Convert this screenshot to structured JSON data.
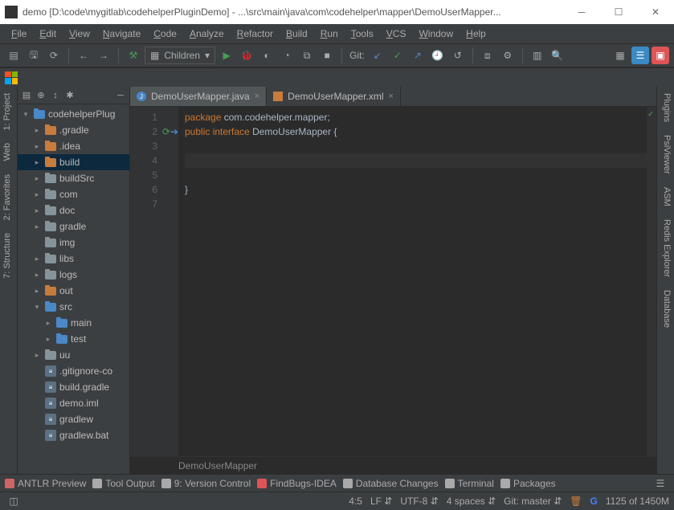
{
  "window": {
    "title": "demo [D:\\code\\mygitlab\\codehelperPluginDemo] - ...\\src\\main\\java\\com\\codehelper\\mapper\\DemoUserMapper..."
  },
  "menubar": [
    "File",
    "Edit",
    "View",
    "Navigate",
    "Code",
    "Analyze",
    "Refactor",
    "Build",
    "Run",
    "Tools",
    "VCS",
    "Window",
    "Help"
  ],
  "toolbar": {
    "config_label": "Children",
    "git_label": "Git:"
  },
  "left_tools": [
    "1: Project",
    "Web",
    "2: Favorites",
    "7: Structure"
  ],
  "right_tools": [
    "Plugins",
    "PsiViewer",
    "ASM",
    "Redis Explorer",
    "Database"
  ],
  "tree": [
    {
      "depth": 0,
      "chev": "▾",
      "folder": "blue",
      "label": "codehelperPlug",
      "sel": false
    },
    {
      "depth": 1,
      "chev": "▸",
      "folder": "orange",
      "label": ".gradle"
    },
    {
      "depth": 1,
      "chev": "▸",
      "folder": "orange",
      "label": ".idea"
    },
    {
      "depth": 1,
      "chev": "▸",
      "folder": "orange",
      "label": "build",
      "sel": true
    },
    {
      "depth": 1,
      "chev": "▸",
      "folder": "grey",
      "label": "buildSrc"
    },
    {
      "depth": 1,
      "chev": "▸",
      "folder": "grey",
      "label": "com"
    },
    {
      "depth": 1,
      "chev": "▸",
      "folder": "grey",
      "label": "doc"
    },
    {
      "depth": 1,
      "chev": "▸",
      "folder": "grey",
      "label": "gradle"
    },
    {
      "depth": 1,
      "chev": "",
      "folder": "grey",
      "label": "img"
    },
    {
      "depth": 1,
      "chev": "▸",
      "folder": "grey",
      "label": "libs"
    },
    {
      "depth": 1,
      "chev": "▸",
      "folder": "grey",
      "label": "logs"
    },
    {
      "depth": 1,
      "chev": "▸",
      "folder": "orange",
      "label": "out"
    },
    {
      "depth": 1,
      "chev": "▾",
      "folder": "blue",
      "label": "src"
    },
    {
      "depth": 2,
      "chev": "▸",
      "folder": "blue",
      "label": "main"
    },
    {
      "depth": 2,
      "chev": "▸",
      "folder": "blue",
      "label": "test"
    },
    {
      "depth": 1,
      "chev": "▸",
      "folder": "grey",
      "label": "uu"
    },
    {
      "depth": 1,
      "chev": "",
      "file": "txt",
      "label": ".gitignore-co"
    },
    {
      "depth": 1,
      "chev": "",
      "file": "gradle",
      "label": "build.gradle"
    },
    {
      "depth": 1,
      "chev": "",
      "file": "iml",
      "label": "demo.iml"
    },
    {
      "depth": 1,
      "chev": "",
      "file": "sh",
      "label": "gradlew"
    },
    {
      "depth": 1,
      "chev": "",
      "file": "bat",
      "label": "gradlew.bat"
    }
  ],
  "tabs": [
    {
      "icon": "java",
      "label": "DemoUserMapper.java",
      "active": true
    },
    {
      "icon": "xml",
      "label": "DemoUserMapper.xml",
      "active": false
    }
  ],
  "code": {
    "lines": [
      {
        "n": 1,
        "html": "<span class='kw'>package</span> <span class='pkg'>com.codehelper.mapper;</span>"
      },
      {
        "n": 2,
        "html": "<span class='kw'>public interface</span> <span class='id'>DemoUserMapper</span> <span class='id'>{</span>"
      },
      {
        "n": 3,
        "html": ""
      },
      {
        "n": 4,
        "html": "",
        "cursor": true
      },
      {
        "n": 5,
        "html": ""
      },
      {
        "n": 6,
        "html": "<span class='id'>}</span>"
      },
      {
        "n": 7,
        "html": ""
      }
    ],
    "breadcrumb": "DemoUserMapper"
  },
  "bottom_tools": [
    {
      "icon": "antlr",
      "label": "ANTLR Preview"
    },
    {
      "icon": "tool",
      "label": "Tool Output"
    },
    {
      "icon": "vcs",
      "label": "9: Version Control"
    },
    {
      "icon": "findbugs",
      "label": "FindBugs-IDEA"
    },
    {
      "icon": "db",
      "label": "Database Changes"
    },
    {
      "icon": "term",
      "label": "Terminal"
    },
    {
      "icon": "pkg",
      "label": "Packages"
    }
  ],
  "status": {
    "cursor": "4:5",
    "line_sep": "LF",
    "encoding": "UTF-8",
    "indent": "4 spaces",
    "git": "Git: master",
    "memory": "1125 of 1450M"
  }
}
